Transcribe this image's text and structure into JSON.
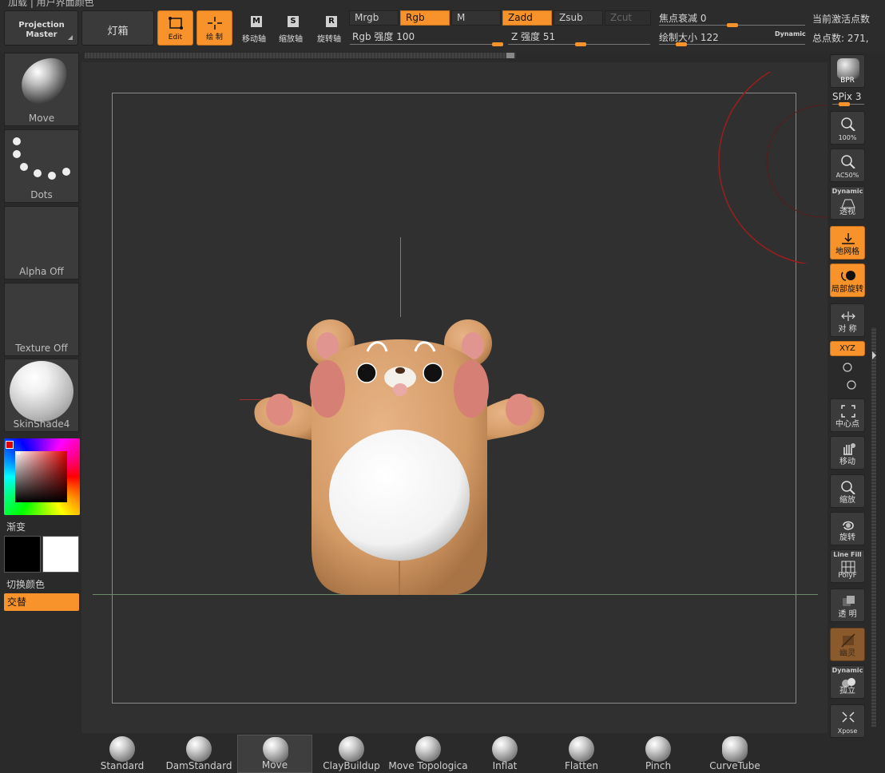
{
  "top_strip": {
    "text": "加载 | 用户界面颜色"
  },
  "toolbar": {
    "projection_master": "Projection Master",
    "lightbox": "灯箱",
    "edit": "Edit",
    "draw": "绘 制",
    "move_axis": "移动轴",
    "move_key": "M",
    "scale_axis": "缩放轴",
    "scale_key": "S",
    "rotate_axis": "旋转轴",
    "rotate_key": "R",
    "mrgb": "Mrgb",
    "rgb": "Rgb",
    "m": "M",
    "zadd": "Zadd",
    "zsub": "Zsub",
    "zcut": "Zcut",
    "rgb_intensity": "Rgb 强度 100",
    "rgb_intensity_value": 100,
    "z_intensity": "Z 强度 51",
    "z_intensity_value": 51,
    "focal_shift": "焦点衰减 0",
    "focal_shift_value": 0,
    "draw_size": "绘制大小 122",
    "draw_size_value": 122,
    "dynamic": "Dynamic",
    "active_points": "当前激活点数",
    "total_points": "总点数: 271,"
  },
  "left_panel": {
    "brush_tile": "Move",
    "stroke_tile": "Dots",
    "alpha_tile": "Alpha Off",
    "texture_tile": "Texture Off",
    "material_tile": "SkinShade4",
    "gradient": "渐变",
    "switch_color": "切换颜色",
    "alternate": "交替"
  },
  "right_panel": {
    "bpr": "BPR",
    "spix": "SPix 3",
    "actual": "100%",
    "aahalf": "AC50%",
    "persp_top": "Dynamic",
    "persp": "透视",
    "floor": "地网格",
    "local": "局部旋转",
    "sym": "对 称",
    "xyz": "XYZ",
    "frame": "中心点",
    "move": "移动",
    "scale": "缩放",
    "rotate": "旋转",
    "linefill_top": "Line Fill",
    "polyf": "PolyF",
    "transp": "透 明",
    "ghost": "幽灵",
    "solo_top": "Dynamic",
    "solo": "孤立",
    "xpose": "Xpose"
  },
  "brushes": [
    {
      "name": "Standard"
    },
    {
      "name": "DamStandard"
    },
    {
      "name": "Move"
    },
    {
      "name": "ClayBuildup"
    },
    {
      "name": "Move Topologica"
    },
    {
      "name": "Inflat"
    },
    {
      "name": "Flatten"
    },
    {
      "name": "Pinch"
    },
    {
      "name": "CurveTube"
    }
  ],
  "colors": {
    "accent": "#f7932a",
    "canvas": "#303030",
    "bear_body": "#d9a270",
    "bear_cheek": "#e0847a",
    "belly": "#ffffff"
  }
}
